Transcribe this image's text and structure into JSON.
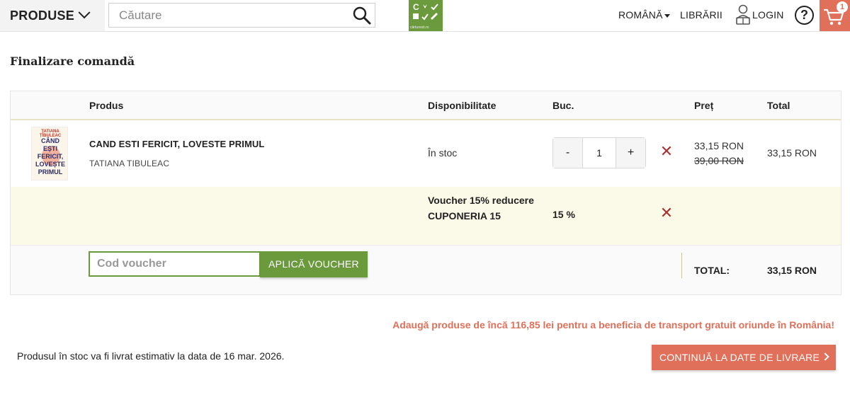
{
  "header": {
    "products_menu": "PRODUSE",
    "search_placeholder": "Căutare",
    "logo_text": "C♥✓ ■✓✓",
    "logo_sub": "cărturesti.ro",
    "language": "ROMÂNĂ",
    "stores": "LIBRĂRII",
    "login": "LOGIN",
    "help": "?",
    "cart_count": "1"
  },
  "page_title": "Finalizare comandă",
  "table": {
    "headers": {
      "product": "Produs",
      "availability": "Disponibilitate",
      "quantity": "Buc.",
      "price": "Preț",
      "total": "Total"
    },
    "item": {
      "cover_author": "TATIANA ȚÎBULEAC",
      "cover_title": "CÂND EȘTI FERICIT, LOVEȘTE PRIMUL",
      "title": "CAND ESTI FERICIT, LOVESTE PRIMUL",
      "author": "TATIANA TIBULEAC",
      "availability": "În stoc",
      "qty_minus": "-",
      "qty_value": "1",
      "qty_plus": "+",
      "price_new": "33,15 RON",
      "price_old": "39,00 RON",
      "total": "33,15 RON"
    },
    "voucher": {
      "name": "Voucher 15% reducere CUPONERIA 15",
      "percent": "15 %"
    },
    "code": {
      "placeholder": "Cod voucher",
      "apply": "APLICĂ VOUCHER"
    },
    "grand_total": {
      "label": "TOTAL:",
      "value": "33,15 RON"
    },
    "remove_symbol": "✕"
  },
  "free_shipping_msg": "Adaugă produse de încă 116,85 lei pentru a beneficia de transport gratuit oriunde în România!",
  "delivery_note": "Produsul în stoc va fi livrat estimativ la data de 16 mar. 2026.",
  "continue_button": "CONTINUĂ LA DATE DE LIVRARE",
  "colors": {
    "accent_green": "#6a9a3c",
    "accent_coral": "#e0705a",
    "remove_red": "#a83232"
  }
}
